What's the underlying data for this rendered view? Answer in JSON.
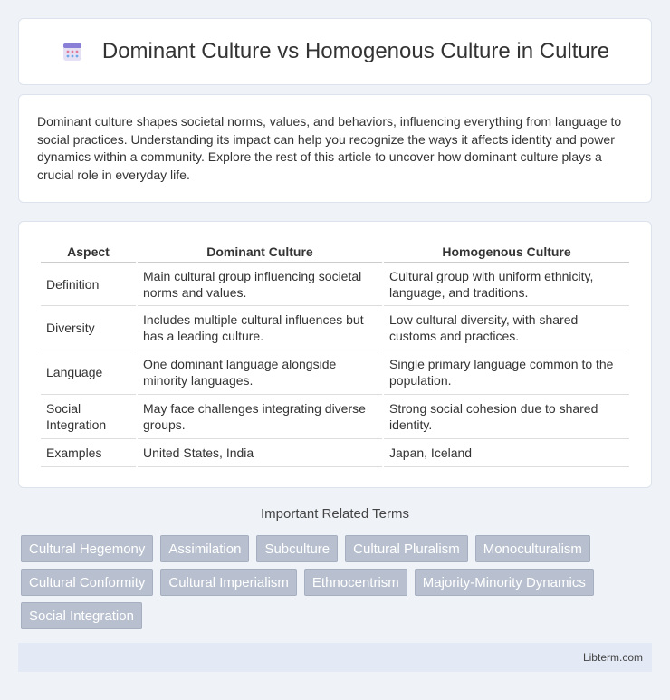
{
  "header": {
    "title": "Dominant Culture vs Homogenous Culture in Culture",
    "icon": "calendar-grid-icon"
  },
  "intro": {
    "text": "Dominant culture shapes societal norms, values, and behaviors, influencing everything from language to social practices. Understanding its impact can help you recognize the ways it affects identity and power dynamics within a community. Explore the rest of this article to uncover how dominant culture plays a crucial role in everyday life."
  },
  "table": {
    "headers": [
      "Aspect",
      "Dominant Culture",
      "Homogenous Culture"
    ],
    "rows": [
      [
        "Definition",
        "Main cultural group influencing societal norms and values.",
        "Cultural group with uniform ethnicity, language, and traditions."
      ],
      [
        "Diversity",
        "Includes multiple cultural influences but has a leading culture.",
        "Low cultural diversity, with shared customs and practices."
      ],
      [
        "Language",
        "One dominant language alongside minority languages.",
        "Single primary language common to the population."
      ],
      [
        "Social Integration",
        "May face challenges integrating diverse groups.",
        "Strong social cohesion due to shared identity."
      ],
      [
        "Examples",
        "United States, India",
        "Japan, Iceland"
      ]
    ]
  },
  "related": {
    "title": "Important Related Terms",
    "tags": [
      "Cultural Hegemony",
      "Assimilation",
      "Subculture",
      "Cultural Pluralism",
      "Monoculturalism",
      "Cultural Conformity",
      "Cultural Imperialism",
      "Ethnocentrism",
      "Majority-Minority Dynamics",
      "Social Integration"
    ]
  },
  "footer": {
    "text": "Libterm.com"
  }
}
